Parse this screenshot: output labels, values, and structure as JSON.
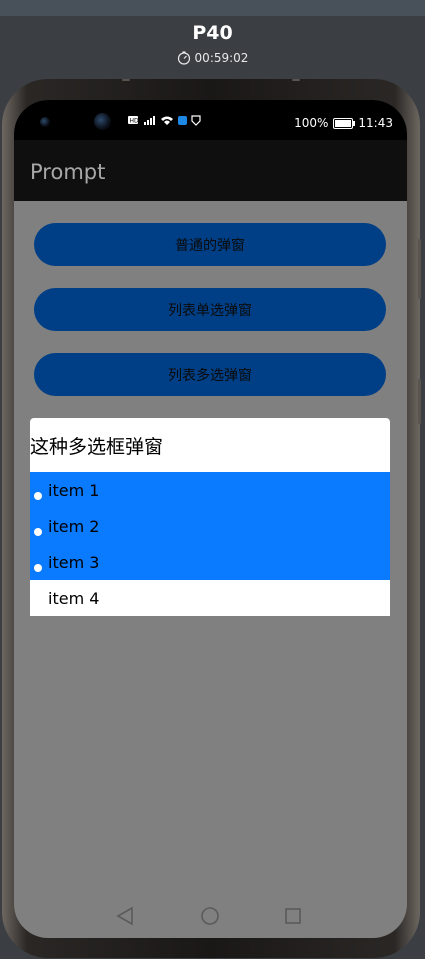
{
  "device": {
    "name": "P40",
    "timer": "00:59:02"
  },
  "status_bar": {
    "battery": "100%",
    "time": "11:43"
  },
  "app": {
    "title": "Prompt"
  },
  "buttons": [
    {
      "label": "普通的弹窗"
    },
    {
      "label": "列表单选弹窗"
    },
    {
      "label": "列表多选弹窗"
    }
  ],
  "dialog": {
    "title": "这种多选框弹窗",
    "items": [
      {
        "label": "item 1",
        "selected": true
      },
      {
        "label": "item 2",
        "selected": true
      },
      {
        "label": "item 3",
        "selected": true
      },
      {
        "label": "item 4",
        "selected": false
      }
    ]
  },
  "colors": {
    "button_bg": "#003f85",
    "selected_bg": "#0a7aff",
    "screen_bg": "#808080",
    "appbar_bg": "#0f0f0f"
  }
}
